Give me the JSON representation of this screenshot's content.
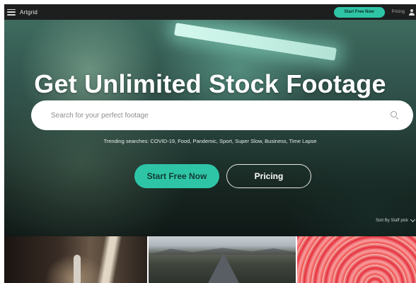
{
  "header": {
    "logo": "Artgrid",
    "cta_label": "Start Free Now",
    "pricing_label": "Pricing"
  },
  "hero": {
    "title": "Get Unlimited Stock Footage",
    "search_placeholder": "Search for your perfect footage",
    "trending": "Trending searches: COVID-19, Food, Pandemic, Sport, Super Slow, Business, Time Lapse",
    "start_label": "Start Free Now",
    "pricing_label": "Pricing",
    "sort_label": "Sort By Staff pick"
  },
  "colors": {
    "accent": "#2ec5a7",
    "header_bg": "#1d1f1f"
  },
  "icons": [
    "menu-icon",
    "user-icon",
    "search-icon",
    "chevron-down-icon"
  ]
}
